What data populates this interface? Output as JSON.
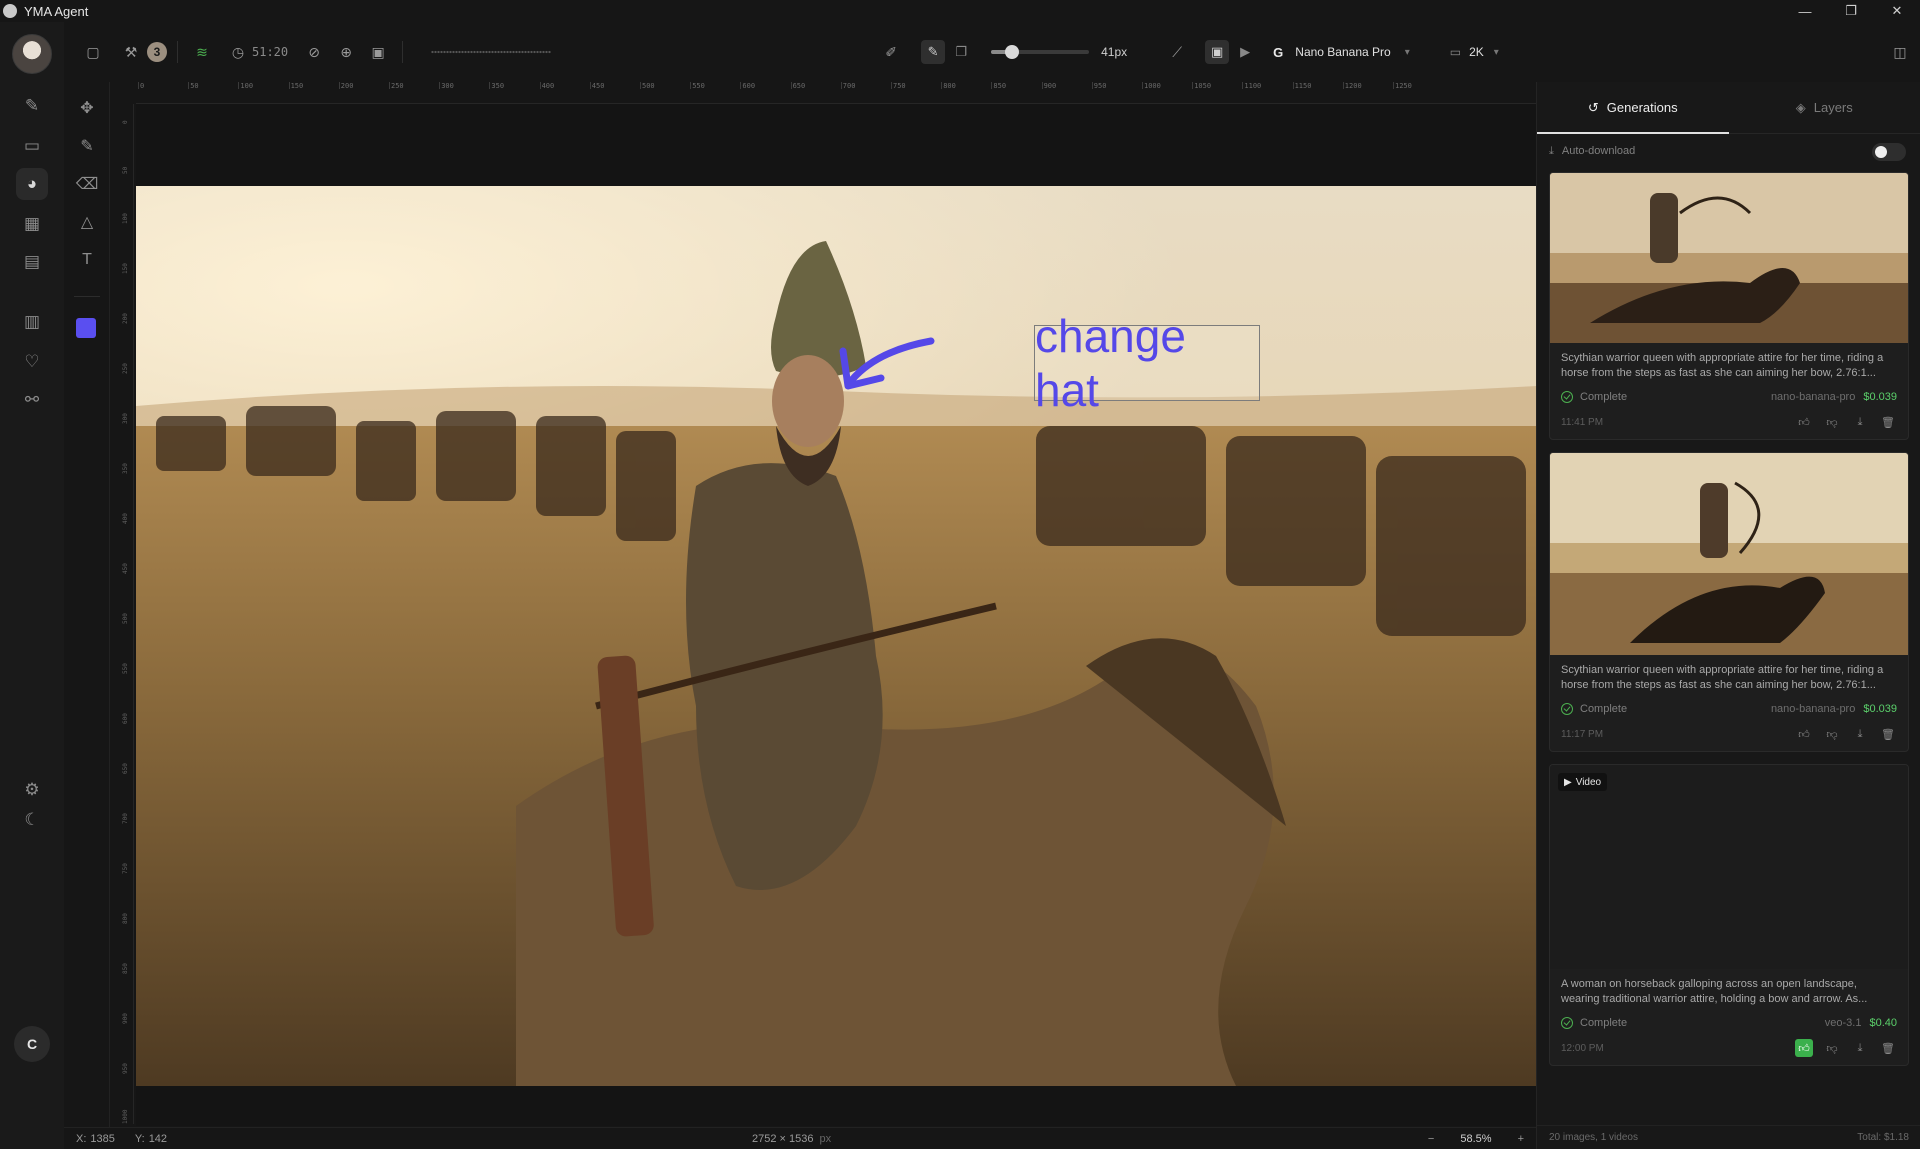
{
  "window": {
    "title": "YMA Agent",
    "minimize": "—",
    "restore": "❐",
    "close": "✕"
  },
  "toolbar": {
    "badge_count": "3",
    "timer": "51:20",
    "brush_size": "41px",
    "model": "Nano Banana Pro",
    "resolution": "2K"
  },
  "rulers": {
    "top": [
      "0",
      "50",
      "100",
      "150",
      "200",
      "250",
      "300",
      "350",
      "400",
      "450",
      "500",
      "550",
      "600",
      "650",
      "700",
      "750",
      "800",
      "850",
      "900",
      "950",
      "1000",
      "1050",
      "1100",
      "1150",
      "1200",
      "1250"
    ],
    "left": [
      "0",
      "50",
      "100",
      "150",
      "200",
      "250",
      "300",
      "350",
      "400",
      "450",
      "500",
      "550",
      "600",
      "650",
      "700",
      "750",
      "800",
      "850",
      "900",
      "950",
      "1000"
    ]
  },
  "canvas": {
    "annotation": "change hat",
    "annotation_color": "#5548e8"
  },
  "status": {
    "x_label": "X:",
    "x": "1385",
    "y_label": "Y:",
    "y": "142",
    "dimensions": "2752 × 1536",
    "unit": "px",
    "zoom": "58.5%",
    "zoom_out": "−",
    "zoom_in": "+"
  },
  "panel": {
    "tabs": [
      "Generations",
      "Layers"
    ],
    "auto_download": "Auto-download",
    "generations": [
      {
        "description": "Scythian warrior queen with appropriate attire for her time, riding a horse from the steps as fast as she can aiming her bow, 2.76:1...",
        "status": "Complete",
        "model": "nano-banana-pro",
        "price": "$0.039",
        "time": "11:41 PM"
      },
      {
        "description": "Scythian warrior queen with appropriate attire for her time, riding a horse from the steps as fast as she can aiming her bow, 2.76:1...",
        "status": "Complete",
        "model": "nano-banana-pro",
        "price": "$0.039",
        "time": "11:17 PM"
      },
      {
        "badge": "Video",
        "description": "A woman on horseback galloping across an open landscape, wearing traditional warrior attire, holding a bow and arrow. As...",
        "status": "Complete",
        "model": "veo-3.1",
        "price": "$0.40",
        "time": "12:00 PM"
      }
    ],
    "footer_count": "20 images, 1 videos",
    "footer_total": "Total: $1.18"
  },
  "colors": {
    "accent": "#5a4ff0",
    "price": "#5bd06b",
    "liked": "#3bb04c"
  }
}
